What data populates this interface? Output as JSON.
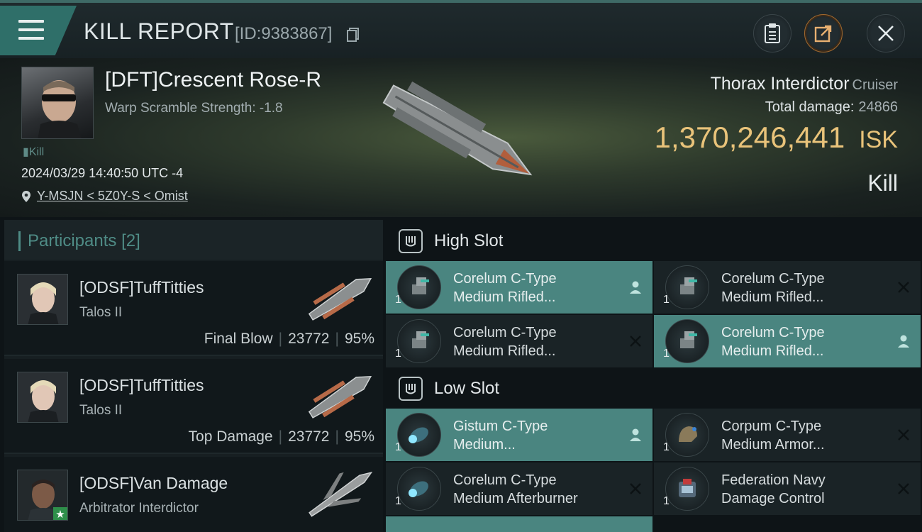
{
  "header": {
    "title": "KILL REPORT",
    "id_text": "[ID:9383867]"
  },
  "victim": {
    "name": "[DFT]Crescent Rose-R",
    "subtitle": "Warp Scramble Strength: -1.8",
    "tag": "Kill",
    "datetime": "2024/03/29 14:40:50 UTC -4",
    "location": "Y-MSJN < 5Z0Y-S < Omist",
    "ship": "Thorax Interdictor",
    "ship_class": "Cruiser",
    "damage_label": "Total damage:",
    "damage_value": "24866",
    "isk_value": "1,370,246,441",
    "isk_unit": "ISK",
    "kill_type": "Kill"
  },
  "participants": {
    "title": "Participants",
    "count": "[2]",
    "items": [
      {
        "name": "[ODSF]TuffTitties",
        "ship": "Talos II",
        "role": "Final Blow",
        "damage": "23772",
        "percent": "95%"
      },
      {
        "name": "[ODSF]TuffTitties",
        "ship": "Talos II",
        "role": "Top Damage",
        "damage": "23772",
        "percent": "95%"
      },
      {
        "name": "[ODSF]Van Damage",
        "ship": "Arbitrator Interdictor"
      }
    ]
  },
  "slots": {
    "high": {
      "title": "High Slot",
      "modules": [
        {
          "name1": "Corelum C-Type",
          "name2": "Medium Rifled...",
          "qty": "1",
          "status": "pilot-icon"
        },
        {
          "name1": "Corelum C-Type",
          "name2": "Medium Rifled...",
          "qty": "1",
          "status": "destroyed-icon"
        },
        {
          "name1": "Corelum C-Type",
          "name2": "Medium Rifled...",
          "qty": "1",
          "status": "destroyed-icon"
        },
        {
          "name1": "Corelum C-Type",
          "name2": "Medium Rifled...",
          "qty": "1",
          "status": "pilot-icon"
        }
      ]
    },
    "low": {
      "title": "Low Slot",
      "modules": [
        {
          "name1": "Gistum C-Type",
          "name2": "Medium...",
          "qty": "1",
          "status": "pilot-icon"
        },
        {
          "name1": "Corpum C-Type",
          "name2": "Medium Armor...",
          "qty": "1",
          "status": "destroyed-icon"
        },
        {
          "name1": "Corelum C-Type",
          "name2": "Medium Afterburner",
          "qty": "1",
          "status": "destroyed-icon"
        },
        {
          "name1": "Federation Navy",
          "name2": "Damage Control",
          "qty": "1",
          "status": "destroyed-icon"
        }
      ]
    }
  },
  "colors": {
    "accent": "#4a8580",
    "isk": "#e9c37a",
    "menu_tab": "#2f6f69"
  }
}
